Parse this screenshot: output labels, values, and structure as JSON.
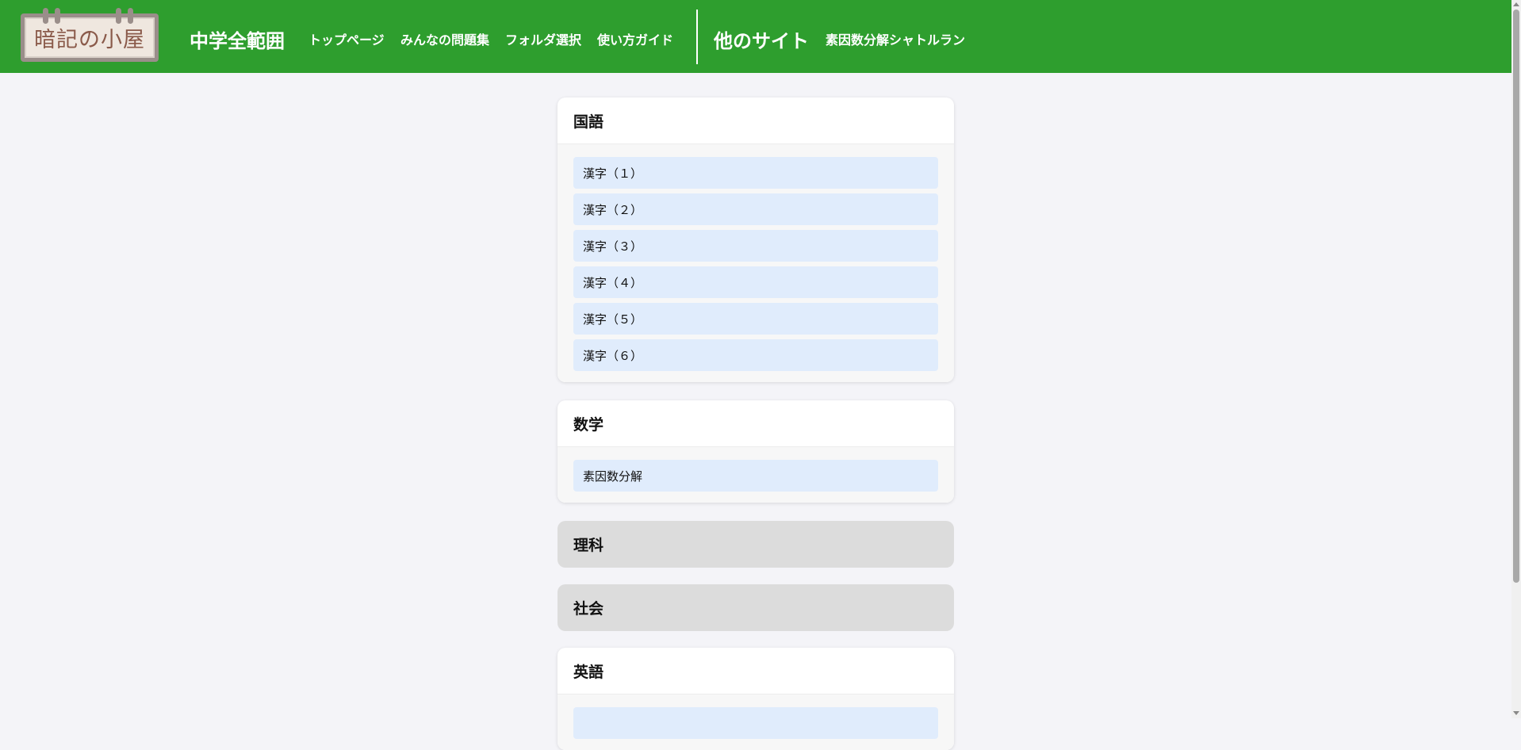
{
  "header": {
    "logo_text": "暗記の小屋",
    "site_title": "中学全範囲",
    "nav": [
      {
        "label": "トップページ"
      },
      {
        "label": "みんなの問題集"
      },
      {
        "label": "フォルダ選択"
      },
      {
        "label": "使い方ガイド"
      }
    ],
    "other_sites_title": "他のサイト",
    "other_sites": [
      {
        "label": "素因数分解シャトルラン"
      }
    ]
  },
  "colors": {
    "header_bg": "#2e9e2e",
    "page_bg": "#f4f4f8",
    "item_bg": "#e0ecfc",
    "collapsed_bg": "#dcdcdc",
    "logo_text": "#8a5a4a"
  },
  "subjects": [
    {
      "title": "国語",
      "expanded": true,
      "items": [
        {
          "label": "漢字（１）"
        },
        {
          "label": "漢字（２）"
        },
        {
          "label": "漢字（３）"
        },
        {
          "label": "漢字（４）"
        },
        {
          "label": "漢字（５）"
        },
        {
          "label": "漢字（６）"
        }
      ]
    },
    {
      "title": "数学",
      "expanded": true,
      "items": [
        {
          "label": "素因数分解"
        }
      ]
    },
    {
      "title": "理科",
      "expanded": false,
      "items": []
    },
    {
      "title": "社会",
      "expanded": false,
      "items": []
    },
    {
      "title": "英語",
      "expanded": true,
      "items": [
        {
          "label": ""
        }
      ]
    }
  ]
}
